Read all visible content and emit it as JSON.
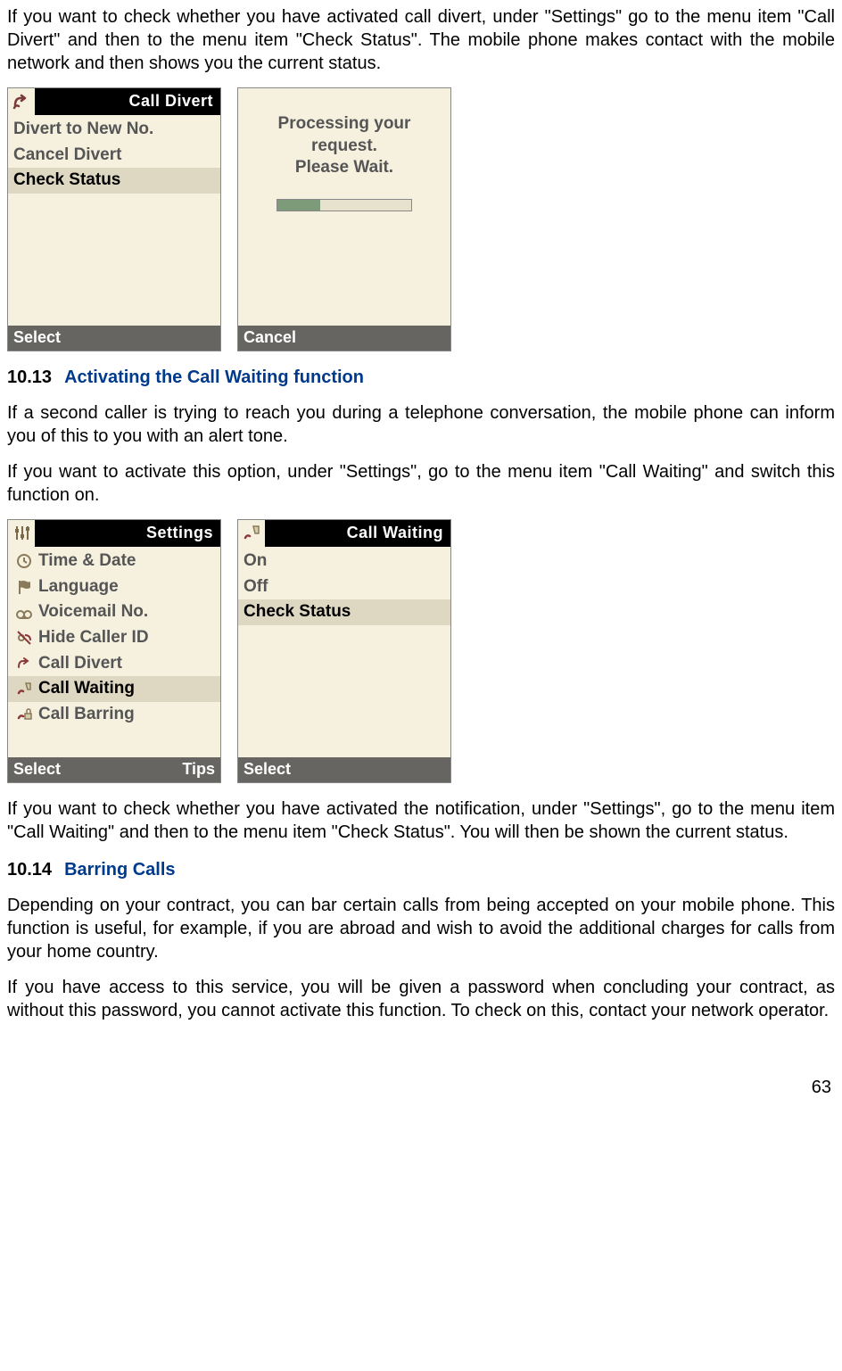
{
  "paragraphs": {
    "intro": "If you want to check whether you have activated call divert, under \"Settings\" go to the menu item \"Call Divert\" and then to the menu item \"Check Status\". The mobile phone makes contact with the mobile network and then shows you the current status.",
    "cw_intro1": "If a second caller is trying to reach you during a telephone conversation, the mobile phone can inform you of this to you with an alert tone.",
    "cw_intro2": "If you want to activate this option, under \"Settings\", go to the menu item \"Call Waiting\" and switch this function on.",
    "cw_check": "If you want to check whether you have activated the notification, under \"Settings\", go to the menu item \"Call Waiting\" and then to the menu item \"Check Status\". You will then be shown the current status.",
    "bar1": "Depending on your contract, you can bar certain calls from being accepted on your mobile phone. This function is useful, for example, if you are abroad and wish to avoid the additional charges for calls from your home country.",
    "bar2": "If you have access to this service, you will be given a password when concluding your contract, as without this password, you cannot activate this function. To check on this, contact your network operator."
  },
  "headings": {
    "s13_num": "10.13",
    "s13_title": "Activating the Call Waiting function",
    "s14_num": "10.14",
    "s14_title": "Barring Calls"
  },
  "screens": {
    "callDivert": {
      "title": "Call Divert",
      "items": [
        "Divert to New No.",
        "Cancel Divert",
        "Check Status"
      ],
      "selectedIndex": 2,
      "softLeft": "Select"
    },
    "processing": {
      "line1": "Processing your",
      "line2": "request.",
      "line3": "Please Wait.",
      "softLeft": "Cancel"
    },
    "settings": {
      "title": "Settings",
      "items": [
        "Time & Date",
        "Language",
        "Voicemail No.",
        "Hide Caller ID",
        "Call Divert",
        "Call Waiting",
        "Call Barring"
      ],
      "selectedIndex": 5,
      "softLeft": "Select",
      "softRight": "Tips"
    },
    "callWaiting": {
      "title": "Call Waiting",
      "items": [
        "On",
        "Off",
        "Check Status"
      ],
      "selectedIndex": 2,
      "softLeft": "Select"
    }
  },
  "pageNumber": "63"
}
